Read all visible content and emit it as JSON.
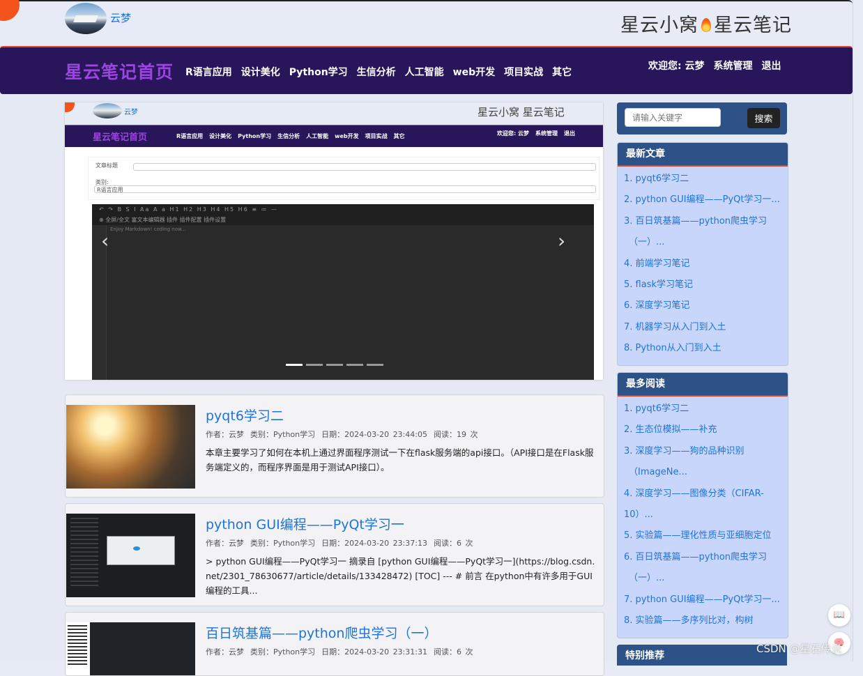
{
  "header": {
    "username": "云梦",
    "brand_left": "星云小窝",
    "brand_right": "星云笔记"
  },
  "nav": {
    "title": "星云笔记首页",
    "menu": [
      "R语言应用",
      "设计美化",
      "Python学习",
      "生信分析",
      "人工智能",
      "web开发",
      "项目实战",
      "其它"
    ],
    "welcome": "欢迎您: 云梦",
    "admin": "系统管理",
    "logout": "退出"
  },
  "carousel": {
    "slide_caption_label": "文章标题",
    "slide_category_label": "类别:",
    "slide_category_value": "R语言应用",
    "editor_toolbar_row1": "↶ ↷  B S I  Aa A a  H1 H2 H3 H4 H5 H6  ≡ ≔ —",
    "editor_toolbar_row2": "⊕  全屏/全文  富文本编辑器  插件  插件配置  插件设置",
    "editor_placeholder": "Enjoy Markdown! coding now...",
    "prev_arrow": "‹",
    "next_arrow": "›",
    "active_slide": 1,
    "slide_count": 5
  },
  "articles": [
    {
      "title": "pyqt6学习二",
      "author": "作者：云梦",
      "category": "类别：Python学习",
      "date": "日期：2024-03-20 23:44:05",
      "reads": "阅读：19 次",
      "desc": "本章主要学习了如何在本机上通过界面程序测试一下在flask服务端的api接口。（API接口是在Flask服务端定义的，而程序界面是用于测试API接口）。"
    },
    {
      "title": "python GUI编程——PyQt学习一",
      "author": "作者：云梦",
      "category": "类别：Python学习",
      "date": "日期：2024-03-20 23:37:13",
      "reads": "阅读：6 次",
      "desc": "> python GUI编程——PyQt学习一 摘录自 [python GUI编程——PyQt学习一](https://blog.csdn.net/2301_78630677/article/details/133428472) [TOC] --- # 前言 在python中有许多用于GUI编程的工具..."
    },
    {
      "title": "百日筑基篇——python爬虫学习（一）",
      "author": "作者：云梦",
      "category": "类别：Python学习",
      "date": "日期：2024-03-20 23:31:31",
      "reads": "阅读：6 次",
      "desc": ""
    }
  ],
  "search": {
    "placeholder": "请输入关键字",
    "button": "搜索"
  },
  "latest": {
    "title": "最新文章",
    "items": [
      "1. pyqt6学习二",
      "2. python GUI编程——PyQt学习一...",
      "3. 百日筑基篇——python爬虫学习",
      "（一）...",
      "4. 前端学习笔记",
      "5. flask学习笔记",
      "6. 深度学习笔记",
      "7. 机器学习从入门到入土",
      "8. Python从入门到入土"
    ]
  },
  "most_read": {
    "title": "最多阅读",
    "items": [
      "1. pyqt6学习二",
      "2. 生态位模拟——补充",
      "3. 深度学习——狗的品种识别",
      "（ImageNe...",
      "4. 深度学习——图像分类（CIFAR-",
      "10）...",
      "5. 实验篇——理化性质与亚细胞定位",
      "6. 百日筑基篇——python爬虫学习",
      "（一）...",
      "7. python GUI编程——PyQt学习一...",
      "8. 实验篇——多序列比对，构树"
    ]
  },
  "recommend": {
    "title": "特别推荐"
  },
  "floating": {
    "book_icon_label": "📖",
    "brain_icon_label": "🧠"
  },
  "watermark": "CSDN @星石传说",
  "colors": {
    "nav_bg": "#29155a",
    "accent_red": "#e4462b",
    "panel_head": "#2c5287",
    "link": "#1e73d8",
    "nav_title": "#9b45e0"
  }
}
